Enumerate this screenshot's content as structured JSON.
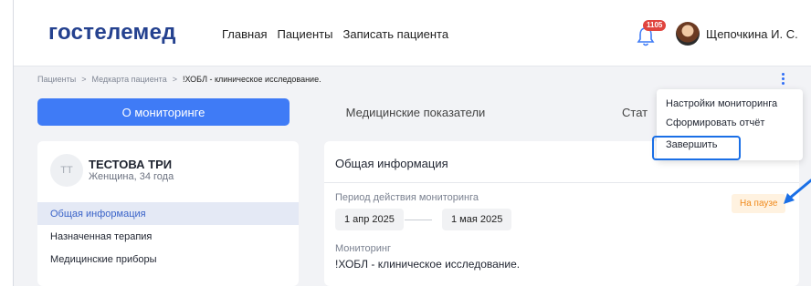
{
  "header": {
    "logo": "гостелемед",
    "nav": [
      "Главная",
      "Пациенты",
      "Записать пациента"
    ],
    "notification_count": "1105",
    "user_name": "Щепочкина И. С."
  },
  "breadcrumb": {
    "items": [
      "Пациенты",
      "Медкарта пациента",
      "!ХОБЛ - клиническое исследование."
    ],
    "separator": ">"
  },
  "tabs": [
    "О мониторинге",
    "Медицинские показатели",
    "Стат"
  ],
  "patient": {
    "initials": "ТТ",
    "name": "ТЕСТОВА ТРИ",
    "details": "Женщина, 34 года",
    "menu": [
      "Общая информация",
      "Назначенная терапия",
      "Медицинские приборы"
    ]
  },
  "info": {
    "title": "Общая информация",
    "period_label": "Период действия мониторинга",
    "date_start": "1 апр 2025",
    "date_end": "1 мая 2025",
    "status": "На паузе",
    "monitoring_label": "Мониторинг",
    "monitoring_value": "!ХОБЛ - клиническое исследование."
  },
  "dropdown": {
    "items": [
      "Настройки мониторинга",
      "Сформировать отчёт",
      "Завершить"
    ]
  },
  "colors": {
    "brand": "#24418f",
    "accent": "#3f7bf6",
    "status_bg": "#fff2e0",
    "status_text": "#f08a1c",
    "highlight": "#1a6fe6"
  }
}
